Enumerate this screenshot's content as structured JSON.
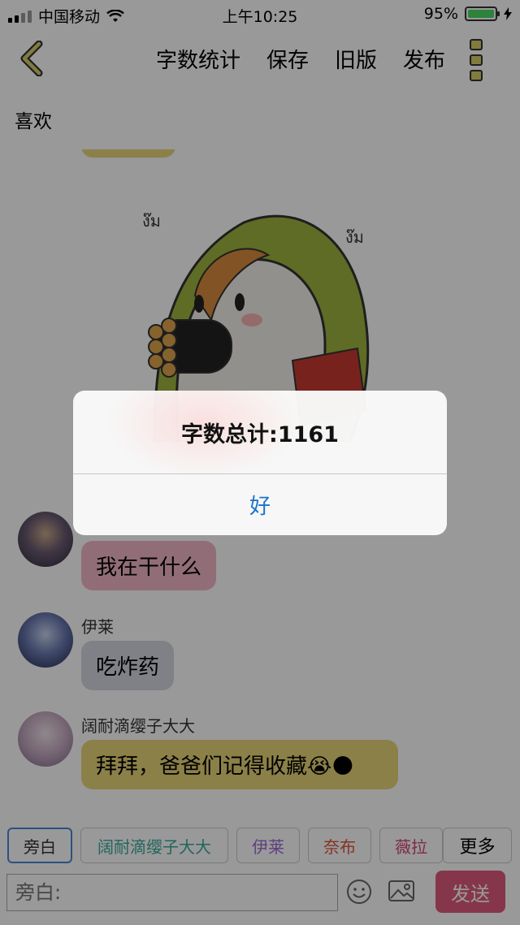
{
  "status_bar": {
    "carrier": "中国移动",
    "time": "上午10:25",
    "battery": "95%",
    "battery_level": 0.95
  },
  "nav": {
    "actions": [
      "字数统计",
      "保存",
      "旧版",
      "发布"
    ]
  },
  "page_title": "喜欢",
  "messages": [
    {
      "speaker": "",
      "text": "我在干什么",
      "bubble_color": "#f2b8c6"
    },
    {
      "speaker": "伊莱",
      "text": "吃炸药",
      "bubble_color": "#d4d8e0"
    },
    {
      "speaker": "阔耐滴缨子大大",
      "text": "拜拜，爸爸们记得收藏",
      "emojis": [
        "😭",
        "🌑"
      ],
      "bubble_color": "#e8d679"
    }
  ],
  "roles": [
    {
      "label": "旁白",
      "color": "#333333",
      "selected": true
    },
    {
      "label": "阔耐滴缨子大大",
      "color": "#3aa89b"
    },
    {
      "label": "伊莱",
      "color": "#9b6ad6"
    },
    {
      "label": "奈布",
      "color": "#e0533e"
    },
    {
      "label": "薇拉",
      "color": "#d0457a"
    },
    {
      "label": "更多",
      "color": "#000000"
    }
  ],
  "input": {
    "placeholder": "旁白:"
  },
  "send_label": "发送",
  "dialog": {
    "title": "字数总计:1161",
    "ok_label": "好"
  },
  "colors": {
    "accent_yellow": "#d8cd6a",
    "send_button": "#e05a7c",
    "dialog_link": "#1a73c9"
  }
}
